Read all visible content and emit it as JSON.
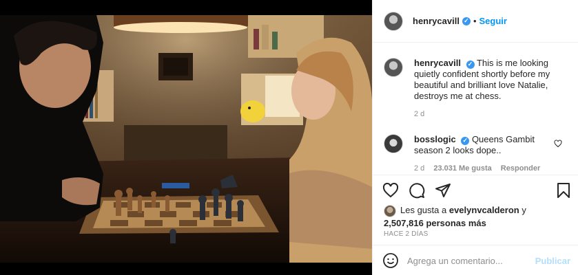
{
  "post": {
    "author": "henrycavill",
    "follow_label": "Seguir",
    "dot": "•",
    "verified_glyph": "✓"
  },
  "comments": [
    {
      "user": "henrycavill",
      "text": "This is me looking quietly confident shortly before my beautiful and brilliant love Natalie, destroys me at chess.",
      "time": "2 d"
    },
    {
      "user": "bosslogic",
      "text": "Queens Gambit season 2 looks dope..",
      "time": "2 d",
      "likes": "23.031 Me gusta",
      "reply_label": "Responder"
    }
  ],
  "likes": {
    "prefix": "Les gusta a",
    "user": "evelynvcalderon",
    "conj": "y",
    "count": "2,507,816 personas más"
  },
  "date": "HACE 2 DÍAS",
  "add_comment": {
    "placeholder": "Agrega un comentario...",
    "submit_label": "Publicar"
  },
  "icons": {
    "verified": "verified-badge-icon",
    "like": "heart-icon",
    "comment": "comment-bubble-icon",
    "share": "paper-plane-icon",
    "save": "bookmark-icon",
    "emoji": "smiley-icon"
  },
  "colors": {
    "link": "#0095f6",
    "verified": "#3897f0",
    "muted": "#8e8e8e",
    "publish_disabled": "#b2dffc",
    "text": "#262626"
  }
}
